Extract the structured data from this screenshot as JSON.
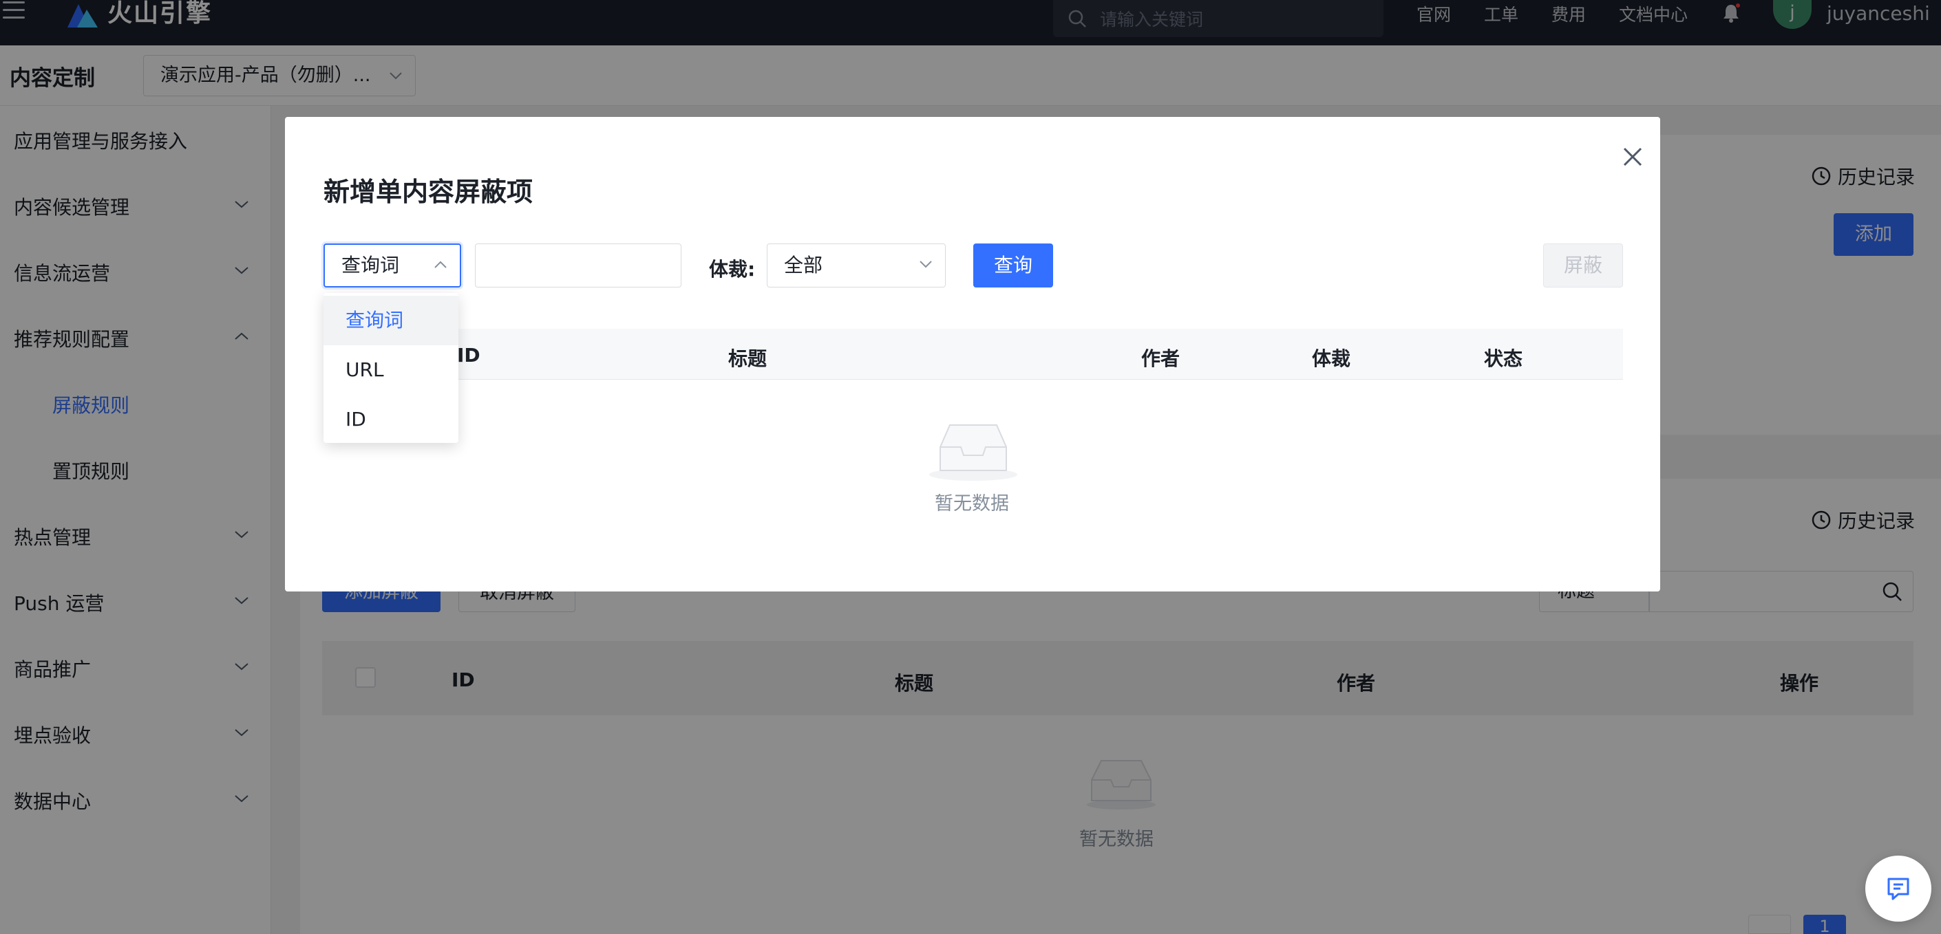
{
  "topbar": {
    "logo_text": "火山引擎",
    "search_placeholder": "请输入关键词",
    "links": [
      "官网",
      "工单",
      "费用",
      "文档中心"
    ],
    "avatar_initial": "j",
    "username": "juyanceshi"
  },
  "page_header": {
    "title": "内容定制",
    "app_select_value": "演示应用-产品（勿删）..."
  },
  "sidebar": {
    "items": [
      {
        "label": "应用管理与服务接入",
        "has_chevron": false
      },
      {
        "label": "内容候选管理",
        "has_chevron": true
      },
      {
        "label": "信息流运营",
        "has_chevron": true
      },
      {
        "label": "推荐规则配置",
        "has_chevron": true,
        "expanded": true
      },
      {
        "label": "屏蔽规则",
        "sub": true,
        "active": true
      },
      {
        "label": "置顶规则",
        "sub": true
      },
      {
        "label": "热点管理",
        "has_chevron": true
      },
      {
        "label": "Push 运营",
        "has_chevron": true
      },
      {
        "label": "商品推广",
        "has_chevron": true
      },
      {
        "label": "埋点验收",
        "has_chevron": true
      },
      {
        "label": "数据中心",
        "has_chevron": true
      }
    ]
  },
  "background": {
    "history_label": "历史记录",
    "add_button": "添加",
    "add_block_button": "添加屏蔽",
    "cancel_block_button": "取消屏蔽",
    "filter_value": "标题",
    "table_columns": [
      "ID",
      "标题",
      "作者",
      "操作"
    ],
    "empty_text": "暂无数据",
    "page": "1"
  },
  "modal": {
    "title": "新增单内容屏蔽项",
    "type_select_value": "查询词",
    "keyword_value": "",
    "genre_label": "体裁:",
    "genre_value": "全部",
    "query_button": "查询",
    "block_button": "屏蔽",
    "table_columns": [
      "ID",
      "标题",
      "作者",
      "体裁",
      "状态"
    ],
    "empty_text": "暂无数据"
  },
  "dropdown": {
    "options": [
      "查询词",
      "URL",
      "ID"
    ],
    "selected": "查询词"
  },
  "colors": {
    "primary": "#3370ff",
    "topbar": "#1b1f2b",
    "overlay": "rgba(0,0,0,0.45)"
  }
}
